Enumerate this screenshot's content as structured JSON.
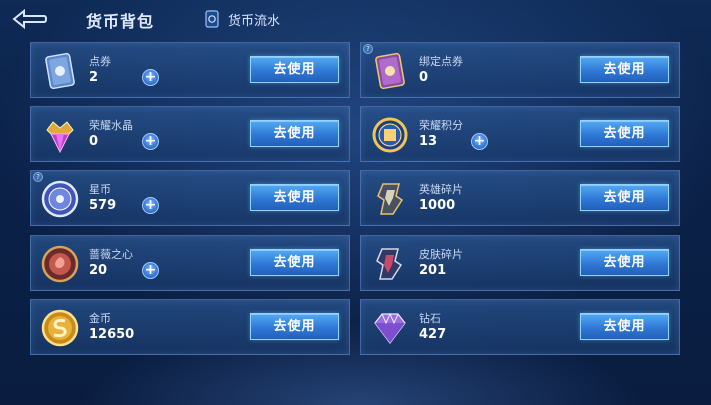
{
  "header": {
    "title": "货币背包",
    "flow_link_label": "货币流水"
  },
  "help_mark": "?",
  "plus_label": "+",
  "items": [
    {
      "name": "点券",
      "amount": "2",
      "action": "去使用",
      "icon": "coupon-card-icon"
    },
    {
      "name": "绑定点券",
      "amount": "0",
      "action": "去使用",
      "icon": "bound-coupon-card-icon"
    },
    {
      "name": "荣耀水晶",
      "amount": "0",
      "action": "去使用",
      "icon": "glory-crystal-icon"
    },
    {
      "name": "荣耀积分",
      "amount": "13",
      "action": "去使用",
      "icon": "glory-points-icon"
    },
    {
      "name": "星币",
      "amount": "579",
      "action": "去使用",
      "icon": "star-coin-icon"
    },
    {
      "name": "英雄碎片",
      "amount": "1000",
      "action": "去使用",
      "icon": "hero-fragment-icon"
    },
    {
      "name": "蔷薇之心",
      "amount": "20",
      "action": "去使用",
      "icon": "rose-heart-icon"
    },
    {
      "name": "皮肤碎片",
      "amount": "201",
      "action": "去使用",
      "icon": "skin-fragment-icon"
    },
    {
      "name": "金币",
      "amount": "12650",
      "action": "去使用",
      "icon": "gold-coin-icon"
    },
    {
      "name": "钻石",
      "amount": "427",
      "action": "去使用",
      "icon": "diamond-icon"
    }
  ]
}
